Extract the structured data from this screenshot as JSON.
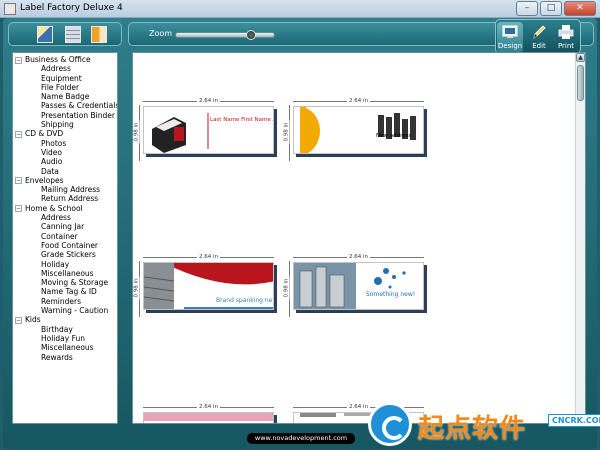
{
  "window": {
    "title": "Label Factory Deluxe 4",
    "minimize": "–",
    "maximize": "□",
    "close": "✕"
  },
  "toolbar": {
    "left_icons": [
      "label-sheet-icon",
      "list-view-icon",
      "template-icon"
    ],
    "zoom_label": "Zoom",
    "zoom_level": 0.78
  },
  "modes": {
    "design": "Design",
    "edit": "Edit",
    "print": "Print"
  },
  "tree": [
    {
      "label": "Business & Office",
      "items": [
        "Address",
        "Equipment",
        "File Folder",
        "Name Badge",
        "Passes & Credentials",
        "Presentation Binder",
        "Shipping"
      ]
    },
    {
      "label": "CD & DVD",
      "items": [
        "Photos",
        "Video",
        "Audio",
        "Data"
      ]
    },
    {
      "label": "Envelopes",
      "items": [
        "Mailing Address",
        "Return Address"
      ]
    },
    {
      "label": "Home & School",
      "items": [
        "Address",
        "Canning Jar",
        "Container",
        "Food Container",
        "Grade Stickers",
        "Holiday",
        "Miscellaneous",
        "Moving & Storage",
        "Name Tag & ID",
        "Reminders",
        "Warning - Caution"
      ]
    },
    {
      "label": "Kids",
      "items": [
        "Birthday",
        "Holiday Fun",
        "Miscellaneous",
        "Rewards"
      ]
    }
  ],
  "tree_toggle": "−",
  "templates": [
    {
      "width": "2.64 in",
      "height": "0.98 in",
      "text": "Last Name First Name Address"
    },
    {
      "width": "2.64 in",
      "height": "0.98 in",
      "text": "New address"
    },
    {
      "width": "2.64 in",
      "height": "0.98 in",
      "text": "Brand spanking new"
    },
    {
      "width": "2.64 in",
      "height": "0.98 in",
      "text": "Something new!"
    },
    {
      "width": "2.64 in",
      "height": ""
    },
    {
      "width": "2.64 in",
      "height": ""
    }
  ],
  "footer": {
    "url": "www.novadevelopment.com"
  },
  "watermark": {
    "text": "起点软件",
    "domain": "CNCRK",
    "domain_suffix": ".COM"
  },
  "colors": {
    "accent_red": "#c0181e",
    "accent_blue": "#1f8fd8",
    "frame_teal": "#1f5e6a",
    "orange": "#f2a900"
  }
}
